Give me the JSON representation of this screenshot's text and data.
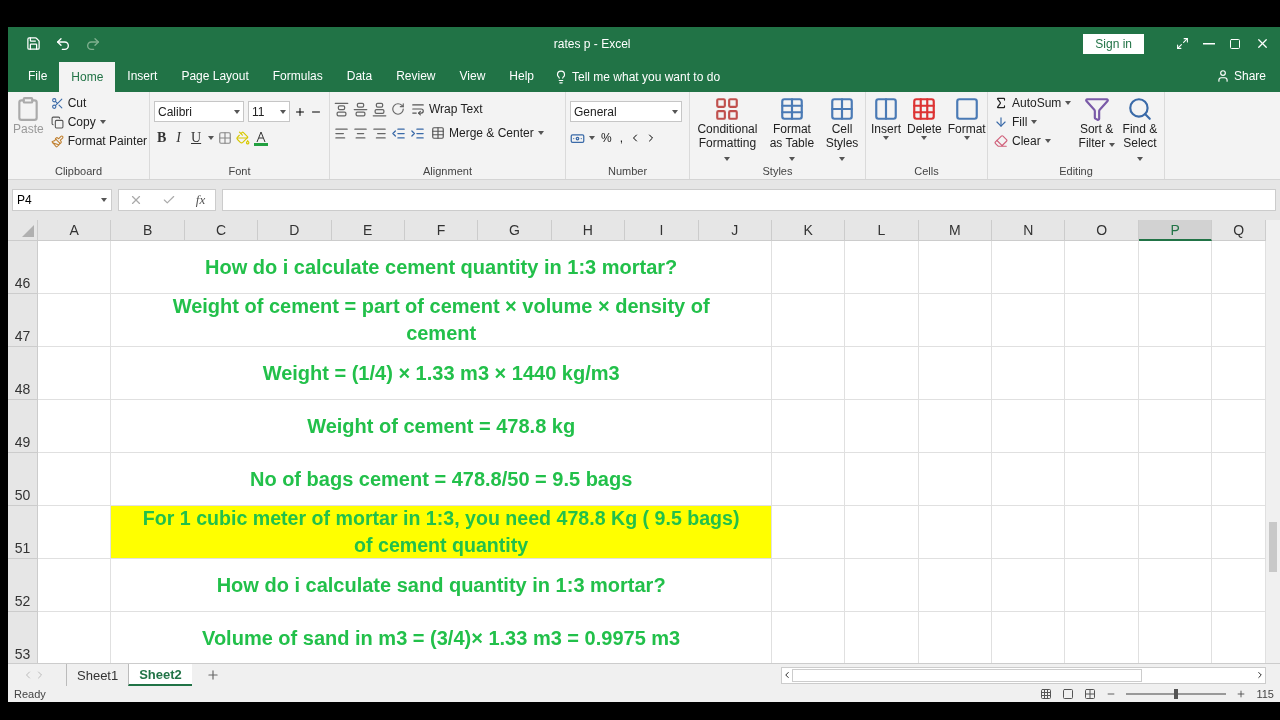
{
  "window": {
    "title": "rates p  -  Excel",
    "sign_in": "Sign in",
    "share": "Share"
  },
  "menu_tabs": [
    {
      "label": "File",
      "selected": false
    },
    {
      "label": "Home",
      "selected": true
    },
    {
      "label": "Insert",
      "selected": false
    },
    {
      "label": "Page Layout",
      "selected": false
    },
    {
      "label": "Formulas",
      "selected": false
    },
    {
      "label": "Data",
      "selected": false
    },
    {
      "label": "Review",
      "selected": false
    },
    {
      "label": "View",
      "selected": false
    },
    {
      "label": "Help",
      "selected": false
    }
  ],
  "tell_me": {
    "placeholder": "Tell me what you want to do"
  },
  "ribbon": {
    "clipboard": {
      "label": "Clipboard",
      "paste": "Paste",
      "cut": "Cut",
      "copy": "Copy",
      "format_painter": "Format Painter"
    },
    "font": {
      "label": "Font",
      "font_name": "Calibri",
      "font_size": "11",
      "bold": "B",
      "italic": "I",
      "underline": "U"
    },
    "alignment": {
      "label": "Alignment",
      "wrap_text": "Wrap Text",
      "merge_center": "Merge & Center"
    },
    "number": {
      "label": "Number",
      "format": "General",
      "percent": "%",
      "comma": ","
    },
    "styles": {
      "label": "Styles",
      "buttons": [
        "Conditional Formatting",
        "Format as Table",
        "Cell Styles"
      ]
    },
    "cells": {
      "label": "Cells",
      "buttons": [
        "Insert",
        "Delete",
        "Format"
      ]
    },
    "editing": {
      "label": "Editing",
      "autosum": "AutoSum",
      "fill": "Fill",
      "clear": "Clear",
      "sort_filter": "Sort & Filter",
      "find_select": "Find & Select"
    }
  },
  "formula_bar": {
    "name_box": "P4",
    "fx": "fx"
  },
  "columns": [
    {
      "label": "A",
      "selected": false
    },
    {
      "label": "B",
      "selected": false
    },
    {
      "label": "C",
      "selected": false
    },
    {
      "label": "D",
      "selected": false
    },
    {
      "label": "E",
      "selected": false
    },
    {
      "label": "F",
      "selected": false
    },
    {
      "label": "G",
      "selected": false
    },
    {
      "label": "H",
      "selected": false
    },
    {
      "label": "I",
      "selected": false
    },
    {
      "label": "J",
      "selected": false
    },
    {
      "label": "K",
      "selected": false
    },
    {
      "label": "L",
      "selected": false
    },
    {
      "label": "M",
      "selected": false
    },
    {
      "label": "N",
      "selected": false
    },
    {
      "label": "O",
      "selected": false
    },
    {
      "label": "P",
      "selected": true
    },
    {
      "label": "Q",
      "selected": false
    }
  ],
  "rows": [
    {
      "number": "46",
      "text": "How do i calculate cement quantity in 1:3 mortar?",
      "highlighted": false
    },
    {
      "number": "47",
      "text": "Weight of cement = part of cement × volume × density of cement",
      "highlighted": false
    },
    {
      "number": "48",
      "text": "Weight = (1/4) × 1.33 m3 × 1440 kg/m3",
      "highlighted": false
    },
    {
      "number": "49",
      "text": "Weight of cement = 478.8 kg",
      "highlighted": false
    },
    {
      "number": "50",
      "text": "No of bags cement = 478.8/50 = 9.5 bags",
      "highlighted": false
    },
    {
      "number": "51",
      "text": "For 1 cubic meter of mortar in 1:3, you need 478.8 Kg ( 9.5 bags) of cement quantity",
      "highlighted": true
    },
    {
      "number": "52",
      "text": "How do i calculate sand quantity in 1:3 mortar?",
      "highlighted": false
    },
    {
      "number": "53",
      "text": "Volume of sand in m3 = (3/4)× 1.33 m3 = 0.9975 m3",
      "highlighted": false
    }
  ],
  "sheets": [
    {
      "label": "Sheet1",
      "selected": false
    },
    {
      "label": "Sheet2",
      "selected": true
    }
  ],
  "status_bar": {
    "status": "Ready",
    "zoom": "115",
    "zoom_slider": {
      "level": 0.5
    }
  }
}
